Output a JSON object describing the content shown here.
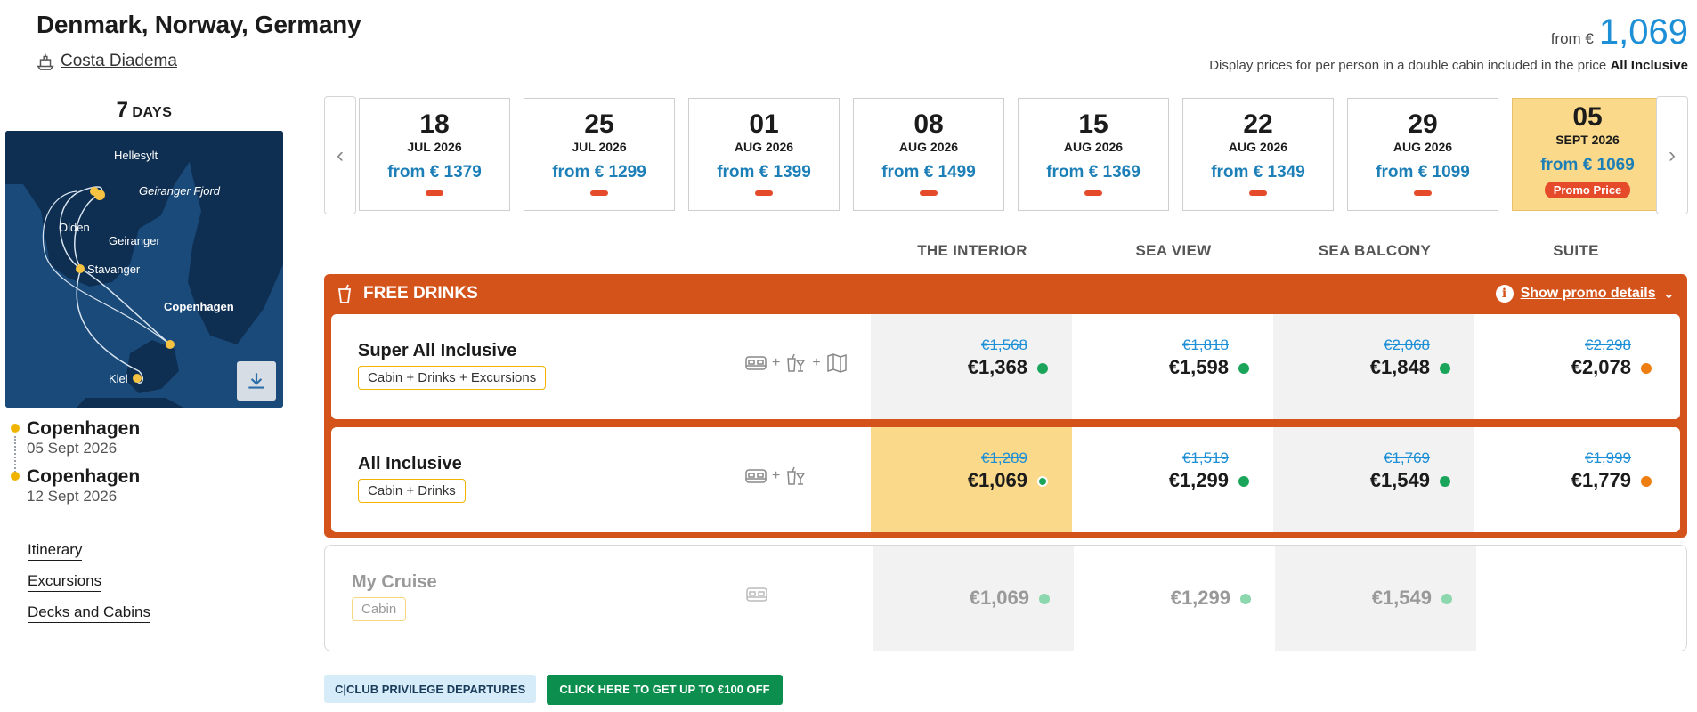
{
  "header": {
    "title": "Denmark, Norway, Germany",
    "ship": "Costa Diadema",
    "from_label": "from €",
    "from_price": "1,069",
    "note_prefix": "Display prices for per person in a double cabin included in the price",
    "note_bold": "All Inclusive"
  },
  "left": {
    "days_num": "7",
    "days_label": "DAYS",
    "map_labels": [
      "Hellesylt",
      "Geiranger Fjord",
      "Olden",
      "Geiranger",
      "Stavanger",
      "Copenhagen",
      "Kiel"
    ],
    "ports": [
      {
        "name": "Copenhagen",
        "date": "05 Sept 2026"
      },
      {
        "name": "Copenhagen",
        "date": "12 Sept 2026"
      }
    ],
    "links": [
      "Itinerary",
      "Excursions",
      "Decks and Cabins"
    ]
  },
  "dates": [
    {
      "day": "18",
      "month": "JUL 2026",
      "price": "from € 1379"
    },
    {
      "day": "25",
      "month": "JUL 2026",
      "price": "from € 1299"
    },
    {
      "day": "01",
      "month": "AUG 2026",
      "price": "from € 1399"
    },
    {
      "day": "08",
      "month": "AUG 2026",
      "price": "from € 1499"
    },
    {
      "day": "15",
      "month": "AUG 2026",
      "price": "from € 1369"
    },
    {
      "day": "22",
      "month": "AUG 2026",
      "price": "from € 1349"
    },
    {
      "day": "29",
      "month": "AUG 2026",
      "price": "from € 1099"
    },
    {
      "day": "05",
      "month": "SEPT 2026",
      "price": "from € 1069",
      "promo": "Promo Price",
      "selected": true
    }
  ],
  "columns": [
    "THE INTERIOR",
    "SEA VIEW",
    "SEA BALCONY",
    "SUITE"
  ],
  "promo": {
    "title": "FREE DRINKS",
    "details": "Show promo details"
  },
  "rates": [
    {
      "name": "Super All Inclusive",
      "tag": "Cabin + Drinks + Excursions",
      "icons": [
        "bed-icon",
        "drinks-icon",
        "map-icon"
      ],
      "prices": [
        {
          "old": "€1,568",
          "new": "€1,368",
          "avail": "green"
        },
        {
          "old": "€1,818",
          "new": "€1,598",
          "avail": "green"
        },
        {
          "old": "€2,068",
          "new": "€1,848",
          "avail": "green"
        },
        {
          "old": "€2,298",
          "new": "€2,078",
          "avail": "orange"
        }
      ]
    },
    {
      "name": "All Inclusive",
      "tag": "Cabin + Drinks",
      "icons": [
        "bed-icon",
        "drinks-icon"
      ],
      "prices": [
        {
          "old": "€1,289",
          "new": "€1,069",
          "avail": "green"
        },
        {
          "old": "€1,519",
          "new": "€1,299",
          "avail": "green"
        },
        {
          "old": "€1,769",
          "new": "€1,549",
          "avail": "green"
        },
        {
          "old": "€1,999",
          "new": "€1,779",
          "avail": "orange"
        }
      ]
    },
    {
      "name": "My Cruise",
      "tag": "Cabin",
      "icons": [
        "bed-icon"
      ],
      "prices": [
        {
          "new": "€1,069",
          "avail": "light-green"
        },
        {
          "new": "€1,299",
          "avail": "light-green"
        },
        {
          "new": "€1,549",
          "avail": "light-green"
        }
      ]
    }
  ],
  "plus": "+",
  "footer": {
    "club": "C|CLUB PRIVILEGE DEPARTURES",
    "offer": "CLICK HERE TO GET UP TO €100 OFF"
  },
  "colors": {
    "accent_blue": "#1d8fd6",
    "promo_orange": "#d4531a",
    "selected_yellow": "#fbd98a",
    "avail_green": "#1aa55a",
    "avail_orange": "#ee7d12",
    "cta_green": "#0c8f4e"
  }
}
